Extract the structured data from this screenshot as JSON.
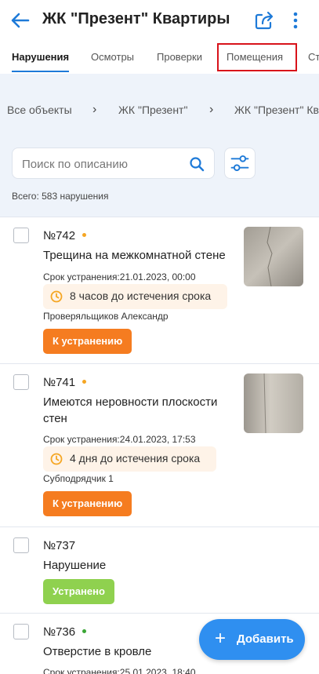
{
  "header": {
    "title": "ЖК \"Презент\" Квартиры",
    "back_icon": "arrow-left-icon",
    "share_icon": "share-icon",
    "more_icon": "more-vertical-icon",
    "accent": "#1e7ad8"
  },
  "tabs": [
    {
      "label": "Нарушения",
      "active": true
    },
    {
      "label": "Осмотры",
      "active": false
    },
    {
      "label": "Проверки",
      "active": false
    },
    {
      "label": "Помещения",
      "active": false,
      "highlighted": true
    },
    {
      "label": "Ст",
      "active": false
    }
  ],
  "breadcrumbs": [
    {
      "label": "Все объекты"
    },
    {
      "label": "ЖК \"Презент\""
    },
    {
      "label": "ЖК \"Презент\" Кв"
    }
  ],
  "breadcrumb_separator": "›",
  "search": {
    "placeholder": "Поиск по описанию",
    "value": ""
  },
  "total": "Всего: 583 нарушения",
  "items": [
    {
      "number": "№742",
      "dot_color": "#f5a623",
      "description": "Трещина на межкомнатной стене",
      "deadline": "Срок устранения:21.01.2023, 00:00",
      "timer": "8 часов до истечения срока",
      "person": "Проверяльщиков Александр",
      "status": "К устранению",
      "status_color": "#f57c20",
      "has_photo": true
    },
    {
      "number": "№741",
      "dot_color": "#f5a623",
      "description": "Имеются неровности плоскости стен",
      "deadline": "Срок устранения:24.01.2023, 17:53",
      "timer": "4 дня до истечения срока",
      "person": "Субподрядчик 1",
      "status": "К устранению",
      "status_color": "#f57c20",
      "has_photo": true
    },
    {
      "number": "№737",
      "description": "Нарушение",
      "status": "Устранено",
      "status_color": "#8fd14f"
    },
    {
      "number": "№736",
      "dot_color": "#3aa635",
      "description": "Отверстие в кровле",
      "deadline": "Срок устранения:25.01.2023, 18:40"
    }
  ],
  "fab": {
    "label": "Добавить",
    "icon": "plus-icon",
    "color": "#2f8ff0"
  }
}
